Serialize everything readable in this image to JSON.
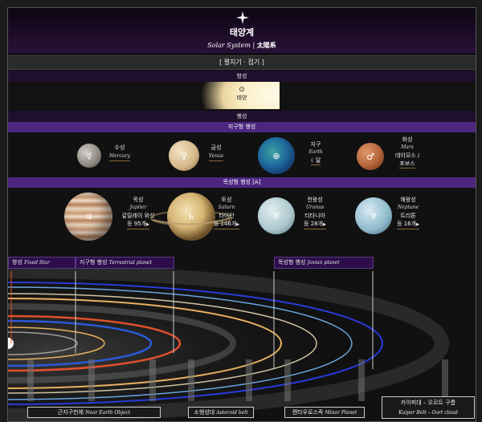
{
  "header": {
    "title": "태양계",
    "subtitle_en": "Solar System",
    "subtitle_sep": " | ",
    "subtitle_zh": "太陽系",
    "star_icon": "four-point-star-icon"
  },
  "toggle": {
    "label": "[ 펼치기 · 접기 ]"
  },
  "sections": {
    "star": "항성",
    "planet": "행성",
    "terrestrial": "지구형 행성",
    "jovian": "목성형 행성 [A]"
  },
  "sun": {
    "symbol": "⊙",
    "name": "태양"
  },
  "terrestrial_planets": [
    {
      "ko": "수성",
      "en": "Mercury",
      "symbol": "☿",
      "color": "#9a958f"
    },
    {
      "ko": "금성",
      "en": "Venus",
      "symbol": "♀",
      "color": "#d9bf91"
    },
    {
      "ko": "지구",
      "en": "Earth",
      "symbol": "⊕",
      "moon": "☾달",
      "color": "#2f6fae"
    },
    {
      "ko": "화성",
      "en": "Mars",
      "symbol": "♂",
      "moons": "데이모스 /",
      "moons2": "포보스",
      "color": "#b8673a"
    }
  ],
  "jovian_planets": [
    {
      "ko": "목성",
      "en": "Jupiter",
      "symbol": "♃",
      "moons": "갈릴레이 위성",
      "count": "등 95개",
      "color": "#c99a76"
    },
    {
      "ko": "토성",
      "en": "Saturn",
      "symbol": "♄",
      "moons": "타이탄",
      "count": "등 146개",
      "color": "#e0c58e"
    },
    {
      "ko": "천왕성",
      "en": "Uranus",
      "symbol": "♅",
      "moons": "티타니아",
      "count": "등 28개",
      "color": "#b9d3d8"
    },
    {
      "ko": "해왕성",
      "en": "Neptune",
      "symbol": "♆",
      "moons": "트리톤",
      "count": "등 16개",
      "color": "#8ab6c8"
    }
  ],
  "zone_tags": {
    "fixed_star_ko": "항성",
    "fixed_star_en": "Fixed Star",
    "terrestrial_ko": "지구형 행성",
    "terrestrial_en": "Terrestrial planet",
    "jovian_ko": "목성형 행성",
    "jovian_en": "Jovian planet"
  },
  "bottom_tags": {
    "neo_ko": "근지구천체",
    "neo_en": "Near Earth Object",
    "asteroid_ko": "소행성대",
    "asteroid_en": "Asteroid belt",
    "centaur_ko": "켄타우로스족",
    "centaur_en": "Minor Planet",
    "kuiper_ko": "카이퍼대 – 오르트 구름",
    "kuiper_en": "Kuiper Belt – Oort cloud"
  },
  "colors": {
    "header_bg": "#1f0f2c",
    "section_purple": "#4c2680",
    "orbit_red": "#e0502a",
    "orbit_blue": "#2a5ad8",
    "orbit_gold": "#e8b060"
  }
}
